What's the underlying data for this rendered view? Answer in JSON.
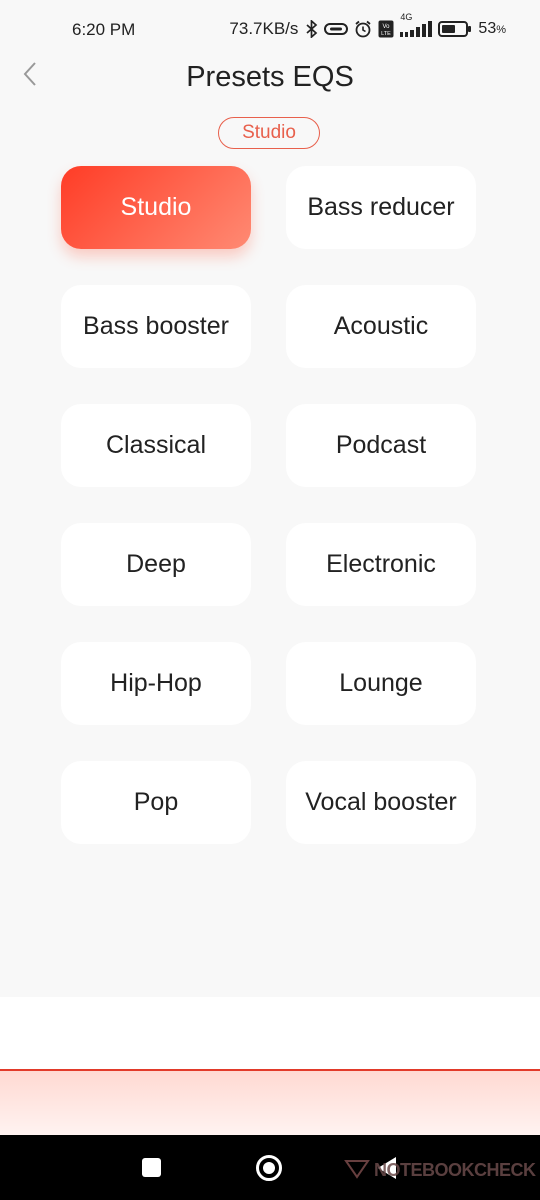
{
  "status_bar": {
    "time": "6:20 PM",
    "network_speed": "73.7KB/s",
    "network_type": "4G",
    "battery_percent": "53",
    "percent_symbol": "%",
    "icons": [
      "bluetooth-icon",
      "link-icon",
      "alarm-icon",
      "volte-icon",
      "signal-icon",
      "battery-icon"
    ]
  },
  "header": {
    "title": "Presets EQS",
    "back_icon": "chevron-left-icon"
  },
  "current_preset": "Studio",
  "presets": [
    {
      "label": "Studio",
      "active": true
    },
    {
      "label": "Bass reducer",
      "active": false
    },
    {
      "label": "Bass booster",
      "active": false
    },
    {
      "label": "Acoustic",
      "active": false
    },
    {
      "label": "Classical",
      "active": false
    },
    {
      "label": "Podcast",
      "active": false
    },
    {
      "label": "Deep",
      "active": false
    },
    {
      "label": "Electronic",
      "active": false
    },
    {
      "label": "Hip-Hop",
      "active": false
    },
    {
      "label": "Lounge",
      "active": false
    },
    {
      "label": "Pop",
      "active": false
    },
    {
      "label": "Vocal booster",
      "active": false
    }
  ],
  "watermark": "NOTEBOOKCHECK",
  "colors": {
    "accent": "#ff3c26",
    "accent_light": "#ff8a73",
    "chip_border": "#e8604c",
    "background": "#f8f8f8"
  }
}
